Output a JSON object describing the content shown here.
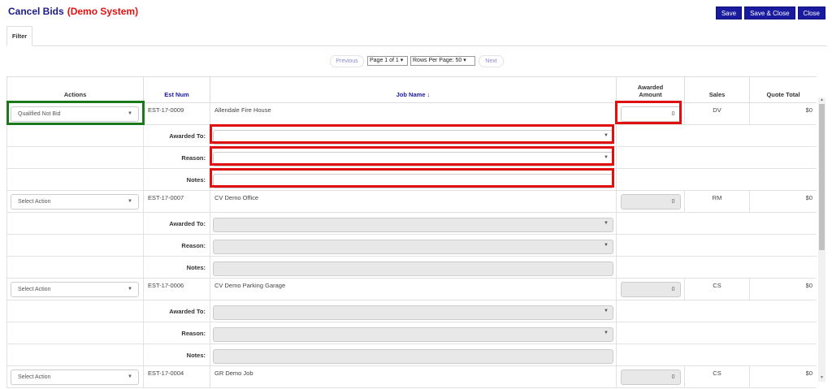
{
  "header": {
    "title": "Cancel Bids",
    "demo_tag": "(Demo System)",
    "buttons": {
      "save": "Save",
      "save_close": "Save & Close",
      "close": "Close"
    }
  },
  "tabs": [
    {
      "label": "Filter"
    }
  ],
  "pager": {
    "previous": "Previous",
    "page": "Page 1 of 1",
    "rows_per_page": "Rows Per Page: 50",
    "next": "Next"
  },
  "table": {
    "headers": {
      "actions": "Actions",
      "est_num": "Est Num",
      "job_name": "Job Name",
      "awarded_amount_1": "Awarded",
      "awarded_amount_2": "Amount",
      "sales": "Sales",
      "quote_total": "Quote Total"
    },
    "sub_labels": {
      "awarded_to": "Awarded To:",
      "reason": "Reason:",
      "notes": "Notes:"
    },
    "rows": [
      {
        "action": "Qualified Not Bid",
        "est_num": "EST-17-0009",
        "job_name": "Allendale Fire House",
        "amount": "0",
        "sales": "DV",
        "quote_total": "$0"
      },
      {
        "action": "Select Action",
        "est_num": "EST-17-0007",
        "job_name": "CV Demo Office",
        "amount": "0",
        "sales": "RM",
        "quote_total": "$0"
      },
      {
        "action": "Select Action",
        "est_num": "EST-17-0006",
        "job_name": "CV Demo Parking Garage",
        "amount": "0",
        "sales": "CS",
        "quote_total": "$0"
      },
      {
        "action": "Select Action",
        "est_num": "EST-17-0004",
        "job_name": "GR Demo Job",
        "amount": "0",
        "sales": "CS",
        "quote_total": "$0"
      }
    ]
  },
  "icons": {
    "sort": "sort-icon",
    "caret": "chevron-down-icon"
  },
  "colors": {
    "brand": "#1a1aa0",
    "demo": "#e01010",
    "highlight_red": "#e01010",
    "highlight_green": "#1a7a1a"
  }
}
